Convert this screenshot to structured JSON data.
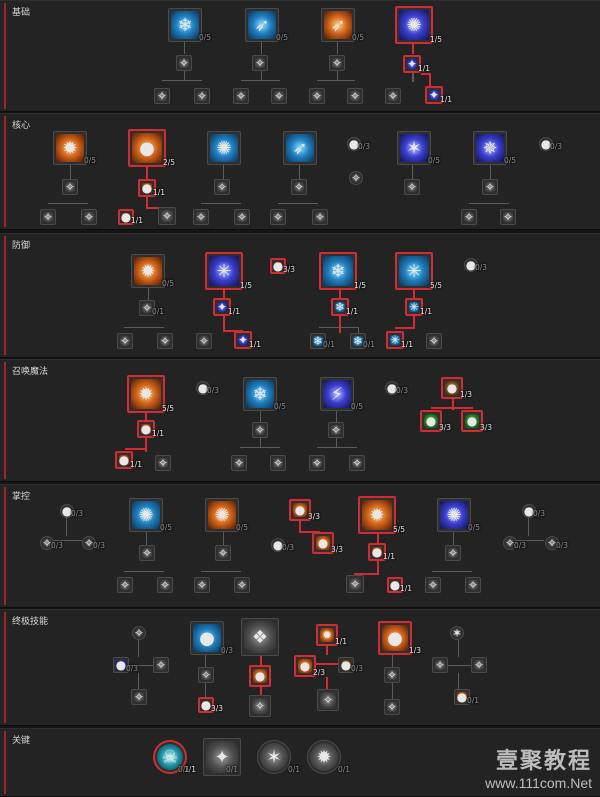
{
  "sections": [
    {
      "title": "基础"
    },
    {
      "title": "核心"
    },
    {
      "title": "防御"
    },
    {
      "title": "召唤魔法"
    },
    {
      "title": "掌控"
    },
    {
      "title": "终极技能"
    },
    {
      "title": "关键"
    }
  ],
  "nodes": [
    {
      "s": 0,
      "icon": "frost-shard-icon",
      "glyph": "❄",
      "theme": "ice",
      "count": "0/5",
      "active": false
    },
    {
      "s": 0,
      "icon": "ice-spear-icon",
      "glyph": "➶",
      "theme": "ice",
      "count": "0/5",
      "active": false
    },
    {
      "s": 0,
      "icon": "fire-spear-icon",
      "glyph": "➶",
      "theme": "fire",
      "count": "0/5",
      "active": false
    },
    {
      "s": 0,
      "icon": "arcane-orb-icon",
      "glyph": "✺",
      "theme": "arcane",
      "count": "1/5",
      "active": true
    },
    {
      "s": 0,
      "icon": "passive-icon",
      "glyph": "✧",
      "theme": "gray",
      "count": "",
      "active": false
    },
    {
      "s": 0,
      "icon": "passive-icon",
      "glyph": "✧",
      "theme": "gray",
      "count": "",
      "active": false
    },
    {
      "s": 0,
      "icon": "passive-icon",
      "glyph": "✧",
      "theme": "gray",
      "count": "",
      "active": false
    },
    {
      "s": 0,
      "icon": "arcane-upgrade-icon",
      "glyph": "✦",
      "theme": "arcane",
      "count": "1/1",
      "active": true
    },
    {
      "s": 0,
      "icon": "passive-icon",
      "glyph": "✧",
      "theme": "gray",
      "count": "",
      "active": false
    },
    {
      "s": 0,
      "icon": "passive-icon",
      "glyph": "✧",
      "theme": "gray",
      "count": "",
      "active": false
    },
    {
      "s": 0,
      "icon": "passive-icon",
      "glyph": "✧",
      "theme": "gray",
      "count": "",
      "active": false
    },
    {
      "s": 0,
      "icon": "passive-icon",
      "glyph": "✧",
      "theme": "gray",
      "count": "",
      "active": false
    },
    {
      "s": 0,
      "icon": "passive-icon",
      "glyph": "✧",
      "theme": "gray",
      "count": "",
      "active": false
    },
    {
      "s": 0,
      "icon": "passive-icon",
      "glyph": "✧",
      "theme": "gray",
      "count": "",
      "active": false
    },
    {
      "s": 0,
      "icon": "passive-icon",
      "glyph": "✧",
      "theme": "gray",
      "count": "",
      "active": false
    },
    {
      "s": 0,
      "icon": "arcane-upgrade-icon",
      "glyph": "✦",
      "theme": "arcane",
      "count": "1/1",
      "active": true
    },
    {
      "s": 1,
      "icon": "fireball-icon",
      "glyph": "✹",
      "theme": "fire",
      "count": "0/5",
      "active": false
    },
    {
      "s": 1,
      "icon": "fire-orb-icon",
      "glyph": "●",
      "theme": "fire",
      "count": "2/5",
      "active": true
    },
    {
      "s": 1,
      "icon": "frost-vortex-icon",
      "glyph": "✺",
      "theme": "ice",
      "count": "",
      "active": false
    },
    {
      "s": 1,
      "icon": "ice-lance-icon",
      "glyph": "➶",
      "theme": "ice",
      "count": "",
      "active": false
    },
    {
      "s": 1,
      "icon": "poison-passive-icon",
      "glyph": "●",
      "theme": "green",
      "count": "0/3",
      "active": false
    },
    {
      "s": 1,
      "icon": "lightning-icon",
      "glyph": "✶",
      "theme": "arcane",
      "count": "0/5",
      "active": false
    },
    {
      "s": 1,
      "icon": "arcane-storm-icon",
      "glyph": "✵",
      "theme": "arcane",
      "count": "0/5",
      "active": false
    },
    {
      "s": 1,
      "icon": "ember-passive-icon",
      "glyph": "●",
      "theme": "amber",
      "count": "0/3",
      "active": false
    },
    {
      "s": 1,
      "icon": "passive-icon",
      "glyph": "✧",
      "theme": "gray",
      "count": "",
      "active": false
    },
    {
      "s": 1,
      "icon": "fire-upgrade-icon",
      "glyph": "●",
      "theme": "fire",
      "count": "1/1",
      "active": true
    },
    {
      "s": 1,
      "icon": "passive-icon",
      "glyph": "✧",
      "theme": "gray",
      "count": "",
      "active": false
    },
    {
      "s": 1,
      "icon": "passive-icon",
      "glyph": "✧",
      "theme": "gray",
      "count": "",
      "active": false
    },
    {
      "s": 1,
      "icon": "passive-icon",
      "glyph": "✧",
      "theme": "gray",
      "count": "",
      "active": false
    },
    {
      "s": 1,
      "icon": "passive-icon",
      "glyph": "✧",
      "theme": "gray",
      "count": "",
      "active": false
    },
    {
      "s": 1,
      "icon": "passive-icon",
      "glyph": "✧",
      "theme": "gray",
      "count": "",
      "active": false
    },
    {
      "s": 1,
      "icon": "passive-icon",
      "glyph": "✧",
      "theme": "gray",
      "count": "",
      "active": false
    },
    {
      "s": 1,
      "icon": "passive-icon",
      "glyph": "✧",
      "theme": "gray",
      "count": "",
      "active": false
    },
    {
      "s": 1,
      "icon": "fire-upgrade-icon",
      "glyph": "●",
      "theme": "fire",
      "count": "1/1",
      "active": true
    },
    {
      "s": 1,
      "icon": "passive-icon",
      "glyph": "✧",
      "theme": "gray",
      "count": "",
      "active": false
    },
    {
      "s": 1,
      "icon": "passive-icon",
      "glyph": "✧",
      "theme": "gray",
      "count": "",
      "active": false
    },
    {
      "s": 1,
      "icon": "passive-icon",
      "glyph": "✧",
      "theme": "gray",
      "count": "",
      "active": false
    },
    {
      "s": 1,
      "icon": "passive-icon",
      "glyph": "✧",
      "theme": "gray",
      "count": "",
      "active": false
    },
    {
      "s": 1,
      "icon": "passive-icon",
      "glyph": "✧",
      "theme": "gray",
      "count": "",
      "active": false
    },
    {
      "s": 1,
      "icon": "passive-icon",
      "glyph": "✧",
      "theme": "gray",
      "count": "",
      "active": false
    },
    {
      "s": 1,
      "icon": "passive-icon",
      "glyph": "✧",
      "theme": "gray",
      "count": "",
      "active": false
    },
    {
      "s": 2,
      "icon": "flame-shield-icon",
      "glyph": "✹",
      "theme": "fire",
      "count": "0/5",
      "active": false
    },
    {
      "s": 2,
      "icon": "frost-nova-icon",
      "glyph": "✳",
      "theme": "arcane",
      "count": "1/5",
      "active": true
    },
    {
      "s": 2,
      "icon": "ember-passive-icon",
      "glyph": "●",
      "theme": "fire",
      "count": "3/3",
      "active": true
    },
    {
      "s": 2,
      "icon": "ice-armor-icon",
      "glyph": "❄",
      "theme": "ice",
      "count": "1/5",
      "active": true
    },
    {
      "s": 2,
      "icon": "frost-burst-icon",
      "glyph": "✳",
      "theme": "ice",
      "count": "5/5",
      "active": true
    },
    {
      "s": 2,
      "icon": "ember-passive-icon",
      "glyph": "●",
      "theme": "amber",
      "count": "0/3",
      "active": false
    },
    {
      "s": 2,
      "icon": "passive-icon",
      "glyph": "✧",
      "theme": "gray",
      "count": "0/1",
      "active": false
    },
    {
      "s": 2,
      "icon": "arcane-upgrade-icon",
      "glyph": "✦",
      "theme": "arcane",
      "count": "1/1",
      "active": true
    },
    {
      "s": 2,
      "icon": "ice-upgrade-icon",
      "glyph": "❄",
      "theme": "ice",
      "count": "1/1",
      "active": true
    },
    {
      "s": 2,
      "icon": "ice-upgrade-icon",
      "glyph": "✳",
      "theme": "ice",
      "count": "1/1",
      "active": true
    },
    {
      "s": 2,
      "icon": "passive-icon",
      "glyph": "✧",
      "theme": "gray",
      "count": "",
      "active": false
    },
    {
      "s": 2,
      "icon": "passive-icon",
      "glyph": "✧",
      "theme": "gray",
      "count": "",
      "active": false
    },
    {
      "s": 2,
      "icon": "passive-icon",
      "glyph": "✧",
      "theme": "gray",
      "count": "",
      "active": false
    },
    {
      "s": 2,
      "icon": "arcane-upgrade-icon",
      "glyph": "✦",
      "theme": "arcane",
      "count": "1/1",
      "active": true
    },
    {
      "s": 2,
      "icon": "ice-upgrade-icon",
      "glyph": "❄",
      "theme": "ice",
      "count": "0/1",
      "active": false
    },
    {
      "s": 2,
      "icon": "ice-upgrade-icon",
      "glyph": "❄",
      "theme": "ice",
      "count": "0/1",
      "active": false
    },
    {
      "s": 2,
      "icon": "ice-upgrade-icon",
      "glyph": "✳",
      "theme": "ice",
      "count": "1/1",
      "active": true
    },
    {
      "s": 2,
      "icon": "passive-icon",
      "glyph": "✧",
      "theme": "gray",
      "count": "",
      "active": false
    },
    {
      "s": 3,
      "icon": "hydra-icon",
      "glyph": "✹",
      "theme": "fire",
      "count": "5/5",
      "active": true
    },
    {
      "s": 3,
      "icon": "ember-passive-icon",
      "glyph": "●",
      "theme": "amber",
      "count": "0/3",
      "active": false
    },
    {
      "s": 3,
      "icon": "ice-blades-icon",
      "glyph": "❄",
      "theme": "ice",
      "count": "0/5",
      "active": false
    },
    {
      "s": 3,
      "icon": "lightning-spear-icon",
      "glyph": "⚡",
      "theme": "arcane",
      "count": "0/5",
      "active": false
    },
    {
      "s": 3,
      "icon": "poison-passive-icon",
      "glyph": "●",
      "theme": "green",
      "count": "0/3",
      "active": false
    },
    {
      "s": 3,
      "icon": "enchant-passive-icon",
      "glyph": "●",
      "theme": "amber",
      "count": "1/3",
      "active": true
    },
    {
      "s": 3,
      "icon": "fire-upgrade-icon",
      "glyph": "●",
      "theme": "fire",
      "count": "1/1",
      "active": true
    },
    {
      "s": 3,
      "icon": "passive-icon",
      "glyph": "✧",
      "theme": "gray",
      "count": "",
      "active": false
    },
    {
      "s": 3,
      "icon": "passive-icon",
      "glyph": "✧",
      "theme": "gray",
      "count": "",
      "active": false
    },
    {
      "s": 3,
      "icon": "enchant-passive-icon",
      "glyph": "●",
      "theme": "green",
      "count": "3/3",
      "active": true
    },
    {
      "s": 3,
      "icon": "enchant-passive-icon",
      "glyph": "●",
      "theme": "green",
      "count": "3/3",
      "active": true
    },
    {
      "s": 3,
      "icon": "fire-upgrade-icon",
      "glyph": "●",
      "theme": "fire",
      "count": "1/1",
      "active": true
    },
    {
      "s": 3,
      "icon": "passive-icon",
      "glyph": "✧",
      "theme": "gray",
      "count": "",
      "active": false
    },
    {
      "s": 3,
      "icon": "passive-icon",
      "glyph": "✧",
      "theme": "gray",
      "count": "",
      "active": false
    },
    {
      "s": 3,
      "icon": "passive-icon",
      "glyph": "✧",
      "theme": "gray",
      "count": "",
      "active": false
    },
    {
      "s": 3,
      "icon": "passive-icon",
      "glyph": "✧",
      "theme": "gray",
      "count": "",
      "active": false
    },
    {
      "s": 3,
      "icon": "passive-icon",
      "glyph": "✧",
      "theme": "gray",
      "count": "",
      "active": false
    },
    {
      "s": 4,
      "icon": "frost-passive-icon",
      "glyph": "●",
      "theme": "ice",
      "count": "0/3",
      "active": false
    },
    {
      "s": 4,
      "icon": "blizzard-icon",
      "glyph": "✺",
      "theme": "ice",
      "count": "0/5",
      "active": false
    },
    {
      "s": 4,
      "icon": "firewall-icon",
      "glyph": "✺",
      "theme": "fire",
      "count": "0/5",
      "active": false
    },
    {
      "s": 4,
      "icon": "fire-passive-icon",
      "glyph": "●",
      "theme": "fire",
      "count": "3/3",
      "active": true
    },
    {
      "s": 4,
      "icon": "meteor-icon",
      "glyph": "✹",
      "theme": "fire",
      "count": "5/5",
      "active": true
    },
    {
      "s": 4,
      "icon": "ball-lightning-icon",
      "glyph": "✺",
      "theme": "arcane",
      "count": "0/5",
      "active": false
    },
    {
      "s": 4,
      "icon": "shock-passive-icon",
      "glyph": "●",
      "theme": "arcane",
      "count": "0/3",
      "active": false
    },
    {
      "s": 4,
      "icon": "passive-icon",
      "glyph": "✧",
      "theme": "gray",
      "count": "0/3",
      "active": false
    },
    {
      "s": 4,
      "icon": "passive-icon",
      "glyph": "✧",
      "theme": "gray",
      "count": "0/3",
      "active": false
    },
    {
      "s": 4,
      "icon": "fire-passive-icon",
      "glyph": "●",
      "theme": "amber",
      "count": "0/3",
      "active": false
    },
    {
      "s": 4,
      "icon": "fire-passive-icon",
      "glyph": "●",
      "theme": "fire",
      "count": "3/3",
      "active": true
    },
    {
      "s": 4,
      "icon": "passive-icon",
      "glyph": "✧",
      "theme": "gray",
      "count": "0/3",
      "active": false
    },
    {
      "s": 4,
      "icon": "passive-icon",
      "glyph": "✧",
      "theme": "gray",
      "count": "0/3",
      "active": false
    },
    {
      "s": 4,
      "icon": "passive-icon",
      "glyph": "✧",
      "theme": "gray",
      "count": "",
      "active": false
    },
    {
      "s": 4,
      "icon": "passive-icon",
      "glyph": "✧",
      "theme": "gray",
      "count": "",
      "active": false
    },
    {
      "s": 4,
      "icon": "fire-upgrade-icon",
      "glyph": "●",
      "theme": "fire",
      "count": "1/1",
      "active": true
    },
    {
      "s": 4,
      "icon": "passive-icon",
      "glyph": "✧",
      "theme": "gray",
      "count": "",
      "active": false
    },
    {
      "s": 4,
      "icon": "passive-icon",
      "glyph": "✧",
      "theme": "gray",
      "count": "",
      "active": false
    },
    {
      "s": 4,
      "icon": "passive-icon",
      "glyph": "✧",
      "theme": "gray",
      "count": "",
      "active": false
    },
    {
      "s": 4,
      "icon": "passive-icon",
      "glyph": "✧",
      "theme": "gray",
      "count": "",
      "active": false
    },
    {
      "s": 4,
      "icon": "passive-icon",
      "glyph": "✧",
      "theme": "gray",
      "count": "",
      "active": false
    },
    {
      "s": 4,
      "icon": "passive-icon",
      "glyph": "✧",
      "theme": "gray",
      "count": "",
      "active": false
    },
    {
      "s": 4,
      "icon": "fire-upgrade-icon",
      "glyph": "●",
      "theme": "fire",
      "count": "1/1",
      "active": true
    },
    {
      "s": 4,
      "icon": "passive-icon",
      "glyph": "✧",
      "theme": "gray",
      "count": "",
      "active": false
    },
    {
      "s": 4,
      "icon": "passive-icon",
      "glyph": "✧",
      "theme": "gray",
      "count": "",
      "active": false
    },
    {
      "s": 4,
      "icon": "passive-icon",
      "glyph": "✧",
      "theme": "gray",
      "count": "",
      "active": false
    },
    {
      "s": 5,
      "icon": "frost-passive-icon",
      "glyph": "●",
      "theme": "ice",
      "count": "0/3",
      "active": false
    },
    {
      "s": 5,
      "icon": "deep-freeze-icon",
      "glyph": "❖",
      "theme": "gray",
      "count": "",
      "active": false
    },
    {
      "s": 5,
      "icon": "inferno-icon",
      "glyph": "✹",
      "theme": "fire",
      "count": "1/1",
      "active": true
    },
    {
      "s": 5,
      "icon": "fire-passive-icon",
      "glyph": "●",
      "theme": "fire",
      "count": "1/3",
      "active": true
    },
    {
      "s": 5,
      "icon": "unstable-currents-icon",
      "glyph": "✶",
      "theme": "gray",
      "count": "",
      "active": false
    },
    {
      "s": 5,
      "icon": "arcane-passive-icon",
      "glyph": "●",
      "theme": "arcane",
      "count": "0/3",
      "active": false
    },
    {
      "s": 5,
      "icon": "passive-icon",
      "glyph": "✧",
      "theme": "gray",
      "count": "",
      "active": false
    },
    {
      "s": 5,
      "icon": "passive-icon",
      "glyph": "✧",
      "theme": "gray",
      "count": "",
      "active": false
    },
    {
      "s": 5,
      "icon": "fire-upgrade-icon",
      "glyph": "●",
      "theme": "fire",
      "count": "",
      "active": true
    },
    {
      "s": 5,
      "icon": "fire-passive-icon",
      "glyph": "●",
      "theme": "fire",
      "count": "2/3",
      "active": true
    },
    {
      "s": 5,
      "icon": "fire-passive-icon",
      "glyph": "●",
      "theme": "amber",
      "count": "0/3",
      "active": false
    },
    {
      "s": 5,
      "icon": "passive-icon",
      "glyph": "✧",
      "theme": "gray",
      "count": "",
      "active": false
    },
    {
      "s": 5,
      "icon": "passive-icon",
      "glyph": "✧",
      "theme": "gray",
      "count": "",
      "active": false
    },
    {
      "s": 5,
      "icon": "passive-icon",
      "glyph": "✧",
      "theme": "gray",
      "count": "",
      "active": false
    },
    {
      "s": 5,
      "icon": "passive-icon",
      "glyph": "✧",
      "theme": "gray",
      "count": "",
      "active": false
    },
    {
      "s": 5,
      "icon": "fire-passive-icon",
      "glyph": "●",
      "theme": "fire",
      "count": "3/3",
      "active": true
    },
    {
      "s": 5,
      "icon": "passive-icon",
      "glyph": "✧",
      "theme": "gray",
      "count": "",
      "active": false
    },
    {
      "s": 5,
      "icon": "passive-icon",
      "glyph": "✧",
      "theme": "gray",
      "count": "",
      "active": false
    },
    {
      "s": 5,
      "icon": "fire-upgrade-icon",
      "glyph": "●",
      "theme": "fire",
      "count": "0/1",
      "active": false
    },
    {
      "s": 6,
      "icon": "key-passive-icon",
      "glyph": "✧",
      "theme": "gray",
      "count": "",
      "active": false
    },
    {
      "s": 6,
      "icon": "esu-blessing-icon",
      "glyph": "☠",
      "theme": "teal",
      "count": "1/1",
      "active": true
    },
    {
      "s": 6,
      "icon": "key-passive-icon",
      "glyph": "✦",
      "theme": "gray",
      "count": "",
      "active": false
    },
    {
      "s": 6,
      "icon": "key-passive-icon",
      "glyph": "✶",
      "theme": "gray",
      "count": "0/1",
      "active": false
    },
    {
      "s": 6,
      "icon": "key-passive-icon",
      "glyph": "✹",
      "theme": "gray",
      "count": "0/1",
      "active": false
    }
  ],
  "counts_extra": [
    "0/1",
    "0/1"
  ],
  "watermark": {
    "text": "壹聚教程",
    "url": "www.111com.Net"
  },
  "colors": {
    "active_border": "#d12b33",
    "panel_bg": "#232323",
    "page_bg": "#151515"
  }
}
